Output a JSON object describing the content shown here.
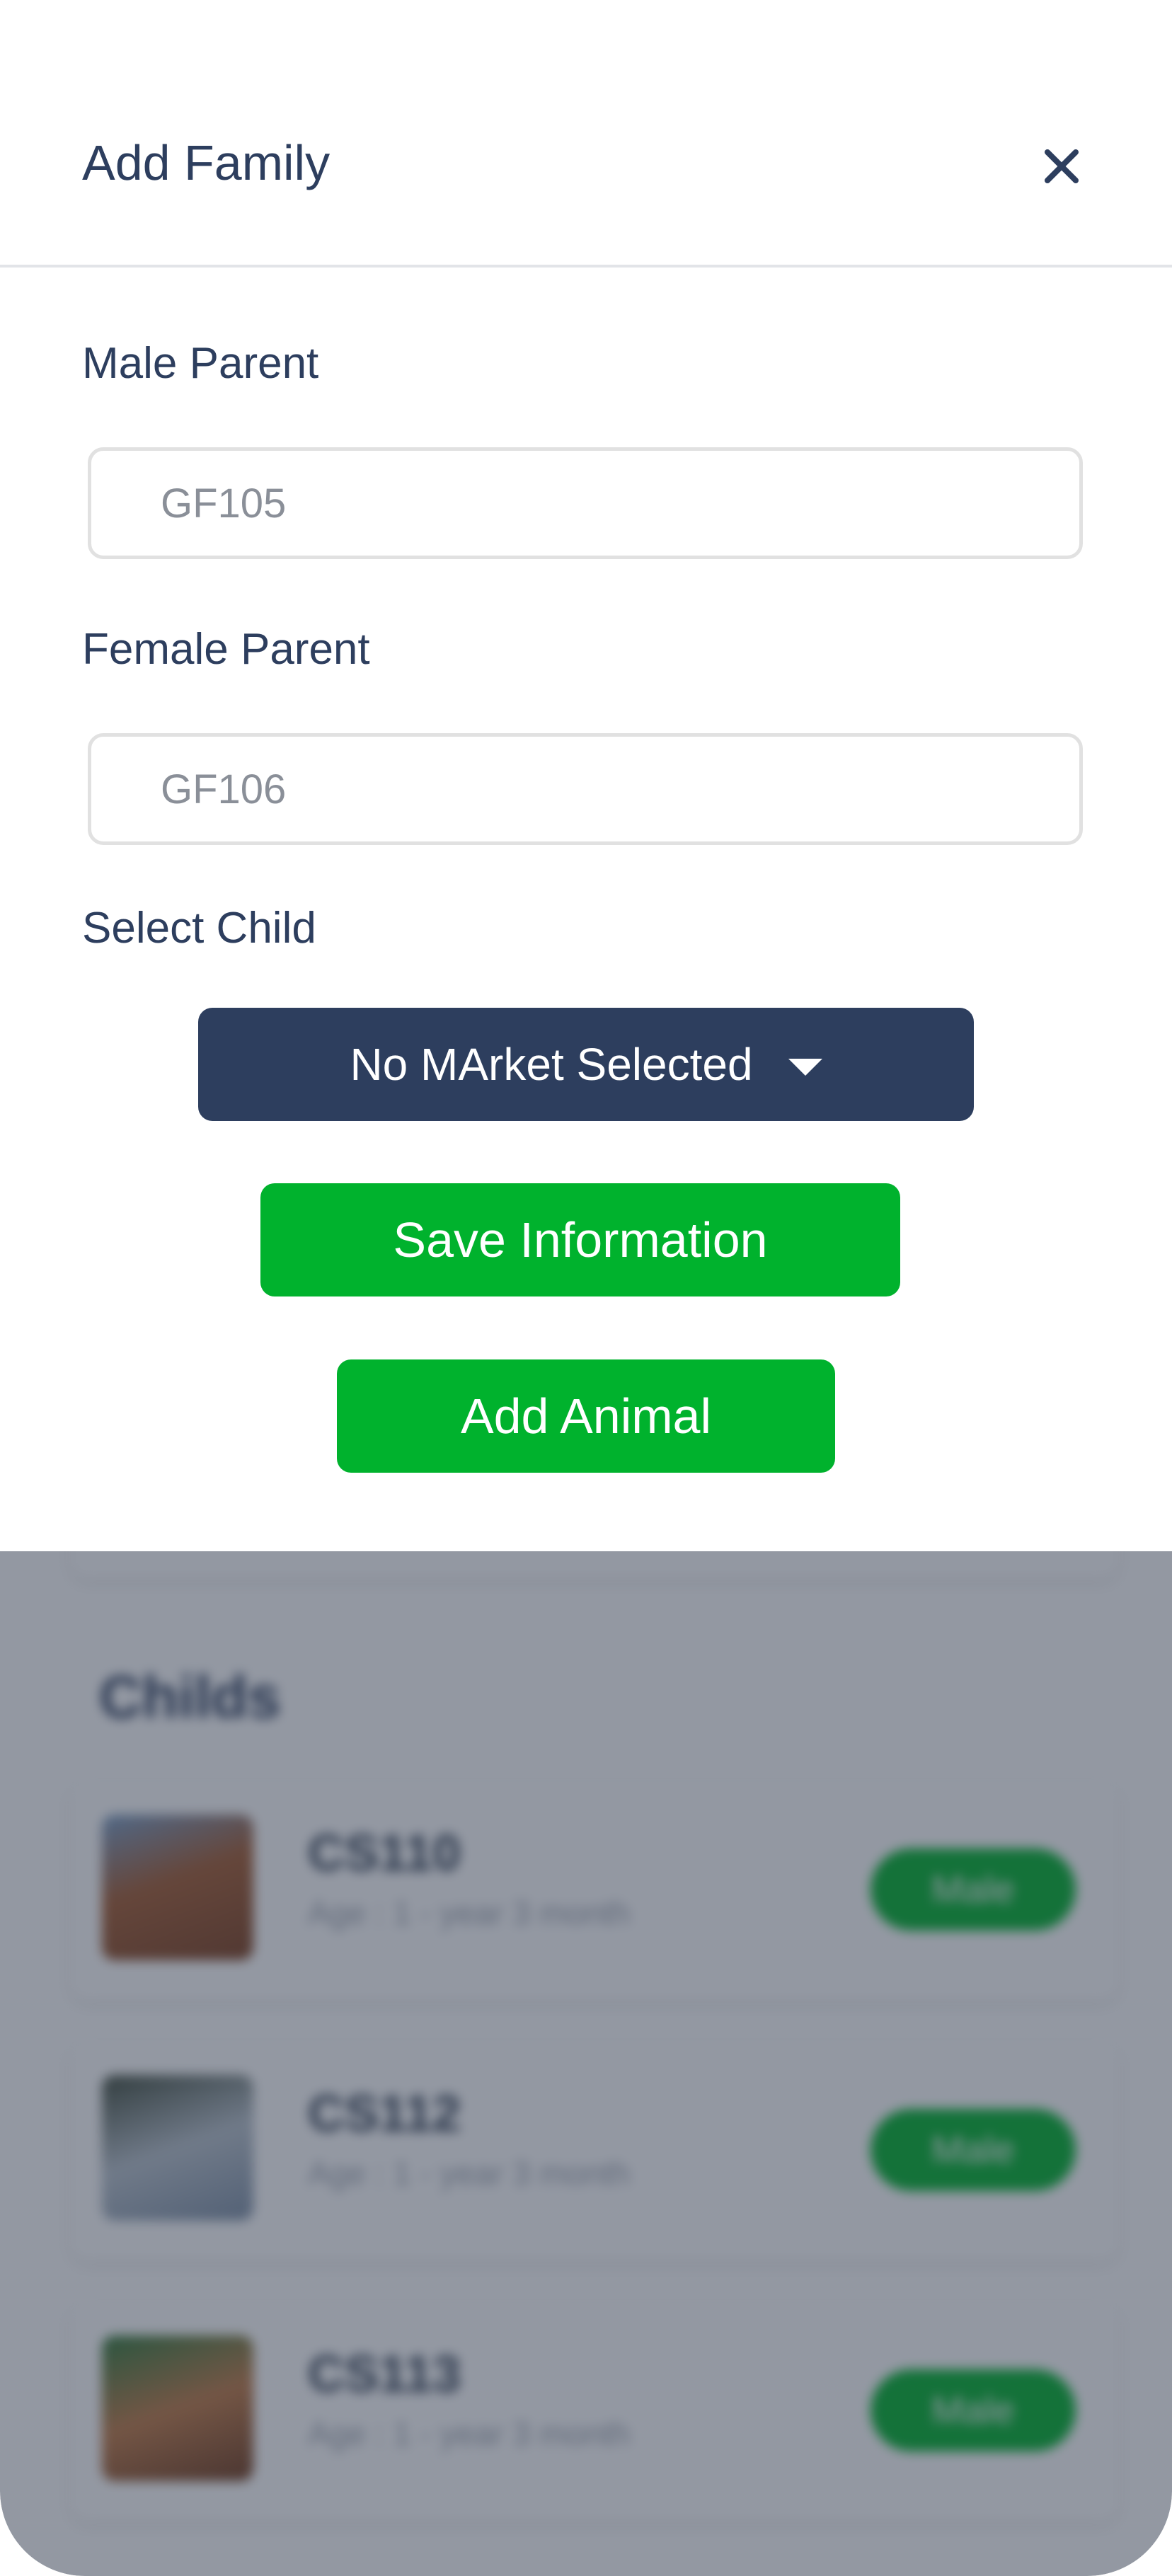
{
  "modal": {
    "title": "Add Family",
    "close_icon": "close-icon",
    "male_parent": {
      "label": "Male Parent",
      "value": "GF105"
    },
    "female_parent": {
      "label": "Female Parent",
      "value": "GF106"
    },
    "select_child": {
      "label": "Select Child",
      "selected": "No MArket Selected"
    },
    "save_label": "Save Information",
    "add_animal_label": "Add Animal"
  },
  "background": {
    "section_title": "Childs",
    "children": [
      {
        "id": "CS110",
        "age": "Age : 1 - year 3 month",
        "gender": "Male"
      },
      {
        "id": "CS112",
        "age": "Age : 1 - year 3 month",
        "gender": "Male"
      },
      {
        "id": "CS113",
        "age": "Age : 1 - year 3 month",
        "gender": "Male"
      }
    ]
  },
  "colors": {
    "primary_navy": "#2d3e5e",
    "accent_green": "#00b22d",
    "overlay": "rgba(40,50,70,0.5)"
  }
}
